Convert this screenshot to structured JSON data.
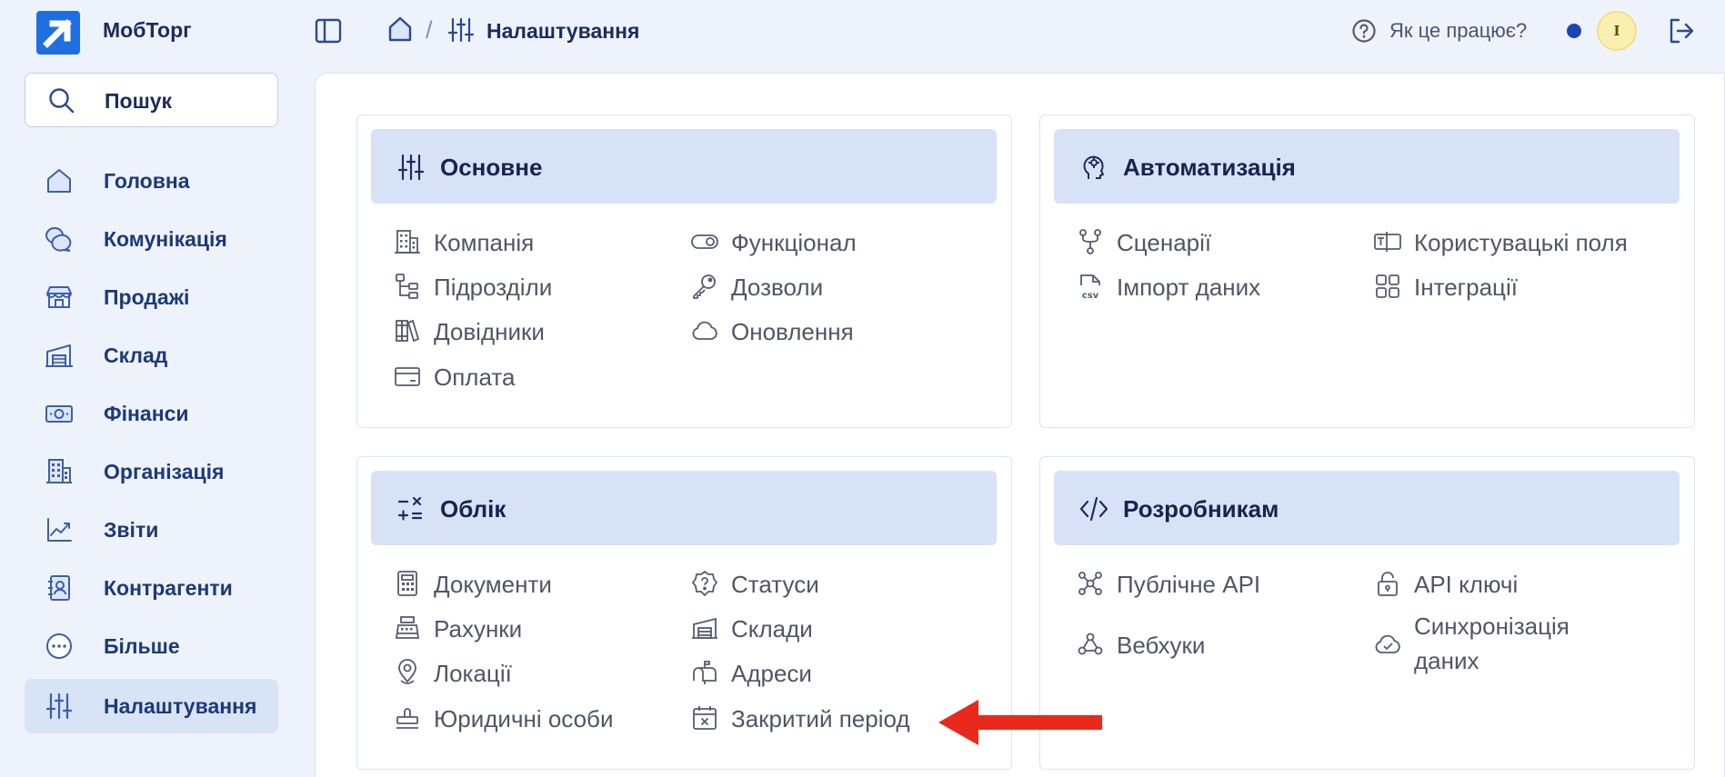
{
  "app": {
    "name": "МобТорг"
  },
  "topbar": {
    "breadcrumb": {
      "separator": "/",
      "current": "Налаштування"
    },
    "help_label": "Як це працює?",
    "avatar_initial": "I"
  },
  "sidebar": {
    "search_label": "Пошук",
    "items": [
      {
        "label": "Головна",
        "icon": "home-icon"
      },
      {
        "label": "Комунікація",
        "icon": "chat-icon"
      },
      {
        "label": "Продажі",
        "icon": "store-icon"
      },
      {
        "label": "Склад",
        "icon": "warehouse-icon"
      },
      {
        "label": "Фінанси",
        "icon": "money-icon"
      },
      {
        "label": "Організація",
        "icon": "building-icon"
      },
      {
        "label": "Звіти",
        "icon": "chart-icon"
      },
      {
        "label": "Контрагенти",
        "icon": "contacts-icon"
      },
      {
        "label": "Більше",
        "icon": "more-icon"
      },
      {
        "label": "Налаштування",
        "icon": "sliders-icon",
        "active": true
      }
    ]
  },
  "cards": {
    "basic": {
      "title": "Основне",
      "links": [
        {
          "label": "Компанія",
          "icon": "building-icon"
        },
        {
          "label": "Підрозділи",
          "icon": "hierarchy-icon"
        },
        {
          "label": "Довідники",
          "icon": "books-icon"
        },
        {
          "label": "Оплата",
          "icon": "credit-card-icon"
        },
        {
          "label": "Функціонал",
          "icon": "toggle-icon"
        },
        {
          "label": "Дозволи",
          "icon": "key-icon"
        },
        {
          "label": "Оновлення",
          "icon": "cloud-icon"
        }
      ]
    },
    "automation": {
      "title": "Автоматизація",
      "links": [
        {
          "label": "Сценарії",
          "icon": "flow-icon"
        },
        {
          "label": "Імпорт даних",
          "icon": "csv-file-icon",
          "icon_text": "csv"
        },
        {
          "label": "Користувацькі поля",
          "icon": "text-field-icon"
        },
        {
          "label": "Інтеграції",
          "icon": "grid-icon"
        }
      ]
    },
    "accounting": {
      "title": "Облік",
      "links": [
        {
          "label": "Документи",
          "icon": "calculator-icon"
        },
        {
          "label": "Рахунки",
          "icon": "cash-register-icon"
        },
        {
          "label": "Локації",
          "icon": "location-pin-icon"
        },
        {
          "label": "Юридичні особи",
          "icon": "stamp-icon"
        },
        {
          "label": "Статуси",
          "icon": "badge-question-icon"
        },
        {
          "label": "Склади",
          "icon": "warehouse-icon"
        },
        {
          "label": "Адреси",
          "icon": "mailbox-icon"
        },
        {
          "label": "Закритий період",
          "icon": "calendar-x-icon"
        }
      ]
    },
    "developers": {
      "title": "Розробникам",
      "links": [
        {
          "label": "Публічне API",
          "icon": "network-icon"
        },
        {
          "label": "Вебхуки",
          "icon": "webhook-icon"
        },
        {
          "label": "API ключі",
          "icon": "lock-icon"
        },
        {
          "label": "Синхронізація даних",
          "icon": "cloud-check-icon"
        }
      ]
    }
  },
  "annotation": {
    "color": "#e8291c"
  },
  "colors": {
    "background": "#eef2fb",
    "card_header": "#d8e2f7",
    "brand": "#1f4fc4",
    "text": "#1c2b5a"
  }
}
